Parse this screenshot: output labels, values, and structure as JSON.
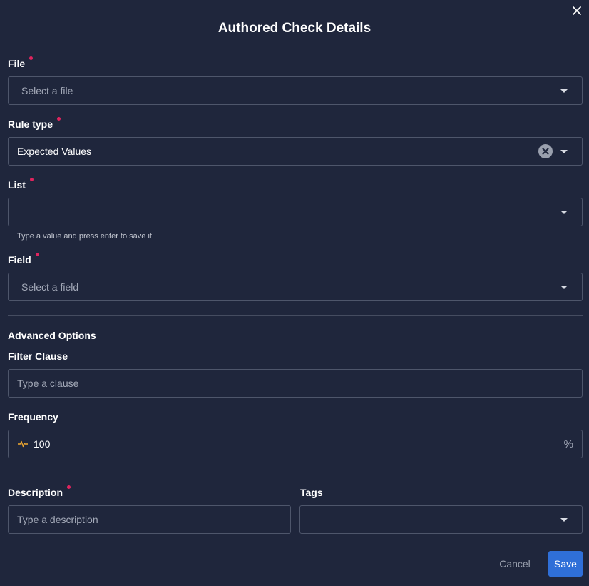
{
  "dialog": {
    "title": "Authored Check Details"
  },
  "file": {
    "label": "File",
    "placeholder": "Select a file"
  },
  "rule_type": {
    "label": "Rule type",
    "value": "Expected Values"
  },
  "list": {
    "label": "List",
    "value": "",
    "hint": "Type a value and press enter to save it"
  },
  "field": {
    "label": "Field",
    "placeholder": "Select a field"
  },
  "advanced": {
    "heading": "Advanced Options",
    "filter_label": "Filter Clause",
    "filter_placeholder": "Type a clause",
    "frequency_label": "Frequency",
    "frequency_value": "100",
    "frequency_unit": "%"
  },
  "description": {
    "label": "Description",
    "placeholder": "Type a description"
  },
  "tags": {
    "label": "Tags",
    "value": ""
  },
  "actions": {
    "cancel": "Cancel",
    "save": "Save"
  },
  "colors": {
    "background": "#1f263c",
    "required": "#e0245e",
    "primary": "#2f6fd8",
    "frequency_icon": "#f0a830"
  }
}
